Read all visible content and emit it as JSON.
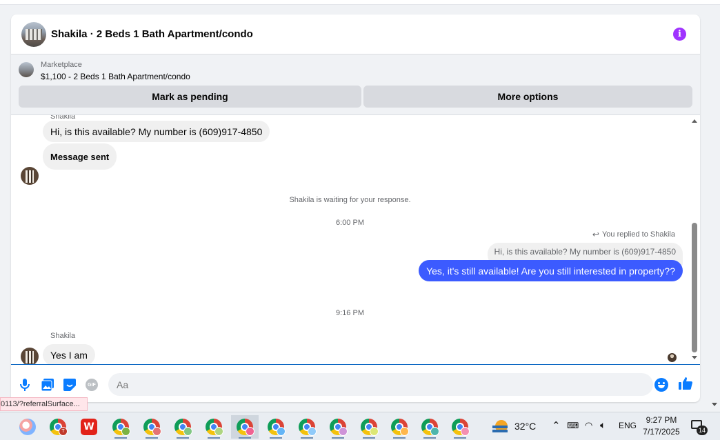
{
  "header": {
    "title": "Shakila · 2 Beds 1 Bath Apartment/condo",
    "info_icon_glyph": "i"
  },
  "marketplace": {
    "label": "Marketplace",
    "listing": "$1,100 - 2 Beds 1 Bath Apartment/condo",
    "pending_button": "Mark as pending",
    "more_button": "More options"
  },
  "messages": {
    "cut_sender": "Shakila",
    "incoming_1": "Hi, is this available? My number is (609)917-4850",
    "incoming_2": "Message sent",
    "system_waiting": "Shakila is waiting for your response.",
    "time_1": "6:00 PM",
    "replied_label": "You replied to Shakila",
    "quoted_text": "Hi, is this available? My number is (609)917-4850",
    "outgoing_1": "Yes, it's still available! Are you still interested in property??",
    "time_2": "9:16 PM",
    "sender_name": "Shakila",
    "incoming_3": "Yes I am"
  },
  "composer": {
    "placeholder": "Aa",
    "icons": [
      "microphone-icon",
      "photo-icon",
      "sticker-icon",
      "gif-icon",
      "emoji-icon",
      "thumbs-up-icon"
    ],
    "gif_label": "GIF"
  },
  "status_bar": {
    "url_fragment": "0113/?referralSurface..."
  },
  "taskbar": {
    "apps": [
      "paint-icon",
      "chrome-icon",
      "wps-office-icon",
      "chrome-icon",
      "chrome-icon",
      "chrome-icon",
      "chrome-icon",
      "chrome-icon",
      "chrome-icon",
      "chrome-icon",
      "chrome-icon",
      "chrome-icon",
      "chrome-icon",
      "chrome-icon",
      "chrome-icon"
    ],
    "chrome_profile_letter": "T",
    "wps_glyph": "W",
    "temperature": "32°C",
    "language": "ENG",
    "time": "9:27 PM",
    "date": "7/17/2025",
    "notification_count": "14"
  },
  "colors": {
    "accent": "#3c5bff",
    "messenger_blue": "#0a7cff",
    "info_purple": "#a033ff"
  }
}
